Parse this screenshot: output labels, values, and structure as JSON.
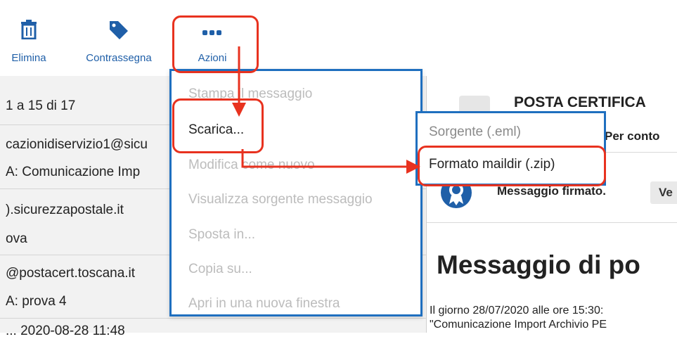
{
  "toolbar": {
    "delete_label": "Elimina",
    "tag_label": "Contrassegna",
    "actions_label": "Azioni",
    "accent": "#1f5fa8",
    "icons": [
      "trash-icon",
      "tag-icon",
      "more-dots-icon"
    ]
  },
  "list": {
    "count": "1 a 15 di 17",
    "rows": [
      "cazionidiservizio1@sicu",
      "A: Comunicazione Imp",
      ").sicurezzapostale.it",
      "ova",
      "@postacert.toscana.it",
      "A: prova 4",
      "...                                                  2020-08-28 11:48"
    ]
  },
  "menu": {
    "items": [
      {
        "label": "Stampa il messaggio",
        "enabled": false
      },
      {
        "label": "Scarica...",
        "enabled": true
      },
      {
        "label": "Modifica come nuovo",
        "enabled": false
      },
      {
        "label": "Visualizza sorgente messaggio",
        "enabled": false
      },
      {
        "label": "Sposta in...",
        "enabled": false
      },
      {
        "label": "Copia su...",
        "enabled": false
      },
      {
        "label": "Apri in una nuova finestra",
        "enabled": false
      }
    ]
  },
  "submenu": {
    "items": [
      {
        "label": "Sorgente (.eml)",
        "enabled": false
      },
      {
        "label": "Formato maildir (.zip)",
        "enabled": true
      }
    ]
  },
  "pane": {
    "subject": "POSTA CERTIFICA",
    "from_prefix": "Per conto",
    "signed_label": "Messaggio firmato.",
    "verify_label": "Ve",
    "title": "Messaggio di po",
    "body_line1": "Il giorno 28/07/2020 alle ore 15:30:",
    "body_line2": "\"Comunicazione Import Archivio PE"
  },
  "colors": {
    "highlight": "#e8321f",
    "menu_border": "#1f6fbf",
    "list_bg": "#f2f2f2"
  }
}
